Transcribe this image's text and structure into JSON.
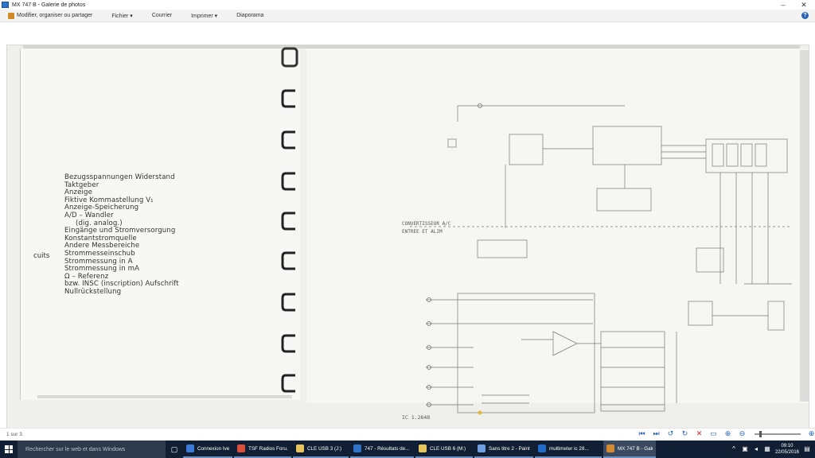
{
  "window": {
    "title": "MX 747 B - Galerie de photos",
    "minimize": "–",
    "close": "✕"
  },
  "commandbar": {
    "items": [
      {
        "label": "Modifier, organiser ou partager",
        "icon": "edit-icon"
      },
      {
        "label": "Fichier ▾"
      },
      {
        "label": "Courrier"
      },
      {
        "label": "Imprimer ▾"
      },
      {
        "label": "Diaporama"
      }
    ],
    "help": "?"
  },
  "document": {
    "list": [
      "Bezugsspannungen Widerstand",
      "Taktgeber",
      "Anzeige",
      "Fiktive Kommastellung V₁",
      "Anzeige-Speicherung",
      "A/D – Wandler",
      "(dig. analog.)",
      "Eingänge und Stromversorgung",
      "Konstantstromquelle",
      "Andere Messbereiche",
      "Strommesseinschub",
      "Strommessung in A",
      "Strommessung in mA",
      "Ω – Referenz",
      "bzw. INSC (inscription) Aufschrift",
      "Nullrückstellung"
    ],
    "side_fragment": "cuits",
    "schematic": {
      "label_converter": "CONVERTISSEUR A/C",
      "label_entry": "ENTREE ET ALIM",
      "ref": "IC 1.2648"
    }
  },
  "statusbar": {
    "count": "1 sur 3"
  },
  "taskbar": {
    "search_placeholder": "Rechercher sur le web et dans Windows",
    "tasks": [
      {
        "label": "Connexion Ivet",
        "color": "#3b7ad8"
      },
      {
        "label": "TSF Radios Foru...",
        "color": "#d94f3a"
      },
      {
        "label": "CLE USB 3 (J:)",
        "color": "#e8c45a"
      },
      {
        "label": "747 - Résultats de...",
        "color": "#2f74c9"
      },
      {
        "label": "CLE USB 6 (M:)",
        "color": "#e8c45a"
      },
      {
        "label": "Sans titre 2 - Paint",
        "color": "#6f9fe0"
      },
      {
        "label": "multimeter ic 28...",
        "color": "#1e6cc8"
      },
      {
        "label": "MX 747 B - Galeri...",
        "color": "#d48a2e"
      }
    ],
    "time": "09:10",
    "date": "22/05/2016"
  }
}
